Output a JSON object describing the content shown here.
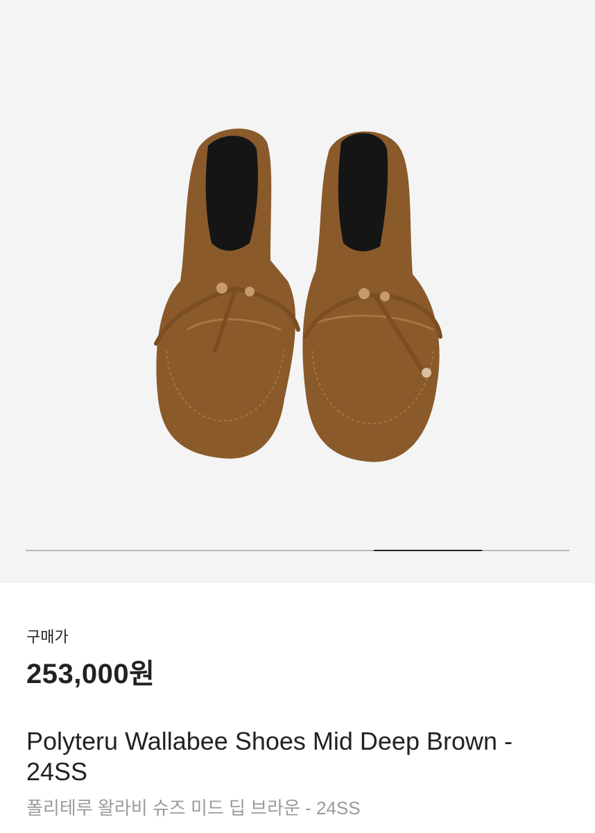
{
  "gallery": {
    "image_alt": "Polyteru Wallabee Shoes Mid Deep Brown",
    "slide_progress": 0.8
  },
  "product": {
    "price_label": "구매가",
    "price": "253,000원",
    "name_en": "Polyteru Wallabee Shoes Mid Deep Brown - 24SS",
    "name_ko": "폴리테루 왈라비 슈즈 미드 딥 브라운 - 24SS"
  },
  "colors": {
    "suede": "#8a5a2b",
    "gallery_bg": "#f4f4f4",
    "text": "#222222",
    "muted": "#9a9a9a"
  }
}
